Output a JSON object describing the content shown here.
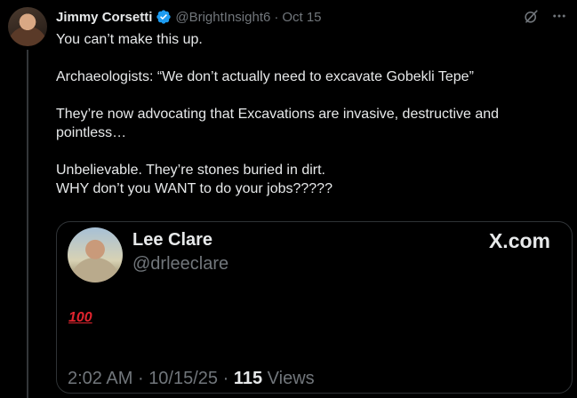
{
  "tweet": {
    "author_name": "Jimmy Corsetti",
    "author_handle": "@BrightInsight6",
    "separator": "·",
    "date": "Oct 15",
    "lines": [
      "You can’t make this up.",
      "Archaeologists: “We don’t actually need to excavate Gobekli Tepe”",
      "They’re now advocating that Excavations are invasive, destructive and",
      "pointless…",
      "Unbelievable. They’re stones buried in dirt.",
      "WHY don’t you WANT to do your jobs?????"
    ]
  },
  "quote": {
    "name": "Lee Clare",
    "handle": "@drleeclare",
    "source": "X.com",
    "emoji_text": "100",
    "time": "2:02 AM",
    "separator": "·",
    "date": "10/15/25",
    "views_count": "115",
    "views_label": "Views"
  },
  "icons": {
    "verified": "verified-badge-icon",
    "grok": "grok-icon",
    "more": "more-icon"
  },
  "colors": {
    "background": "#000000",
    "text": "#e7e9ea",
    "muted": "#71767b",
    "verified": "#1d9bf0",
    "emoji": "#e0242e"
  }
}
